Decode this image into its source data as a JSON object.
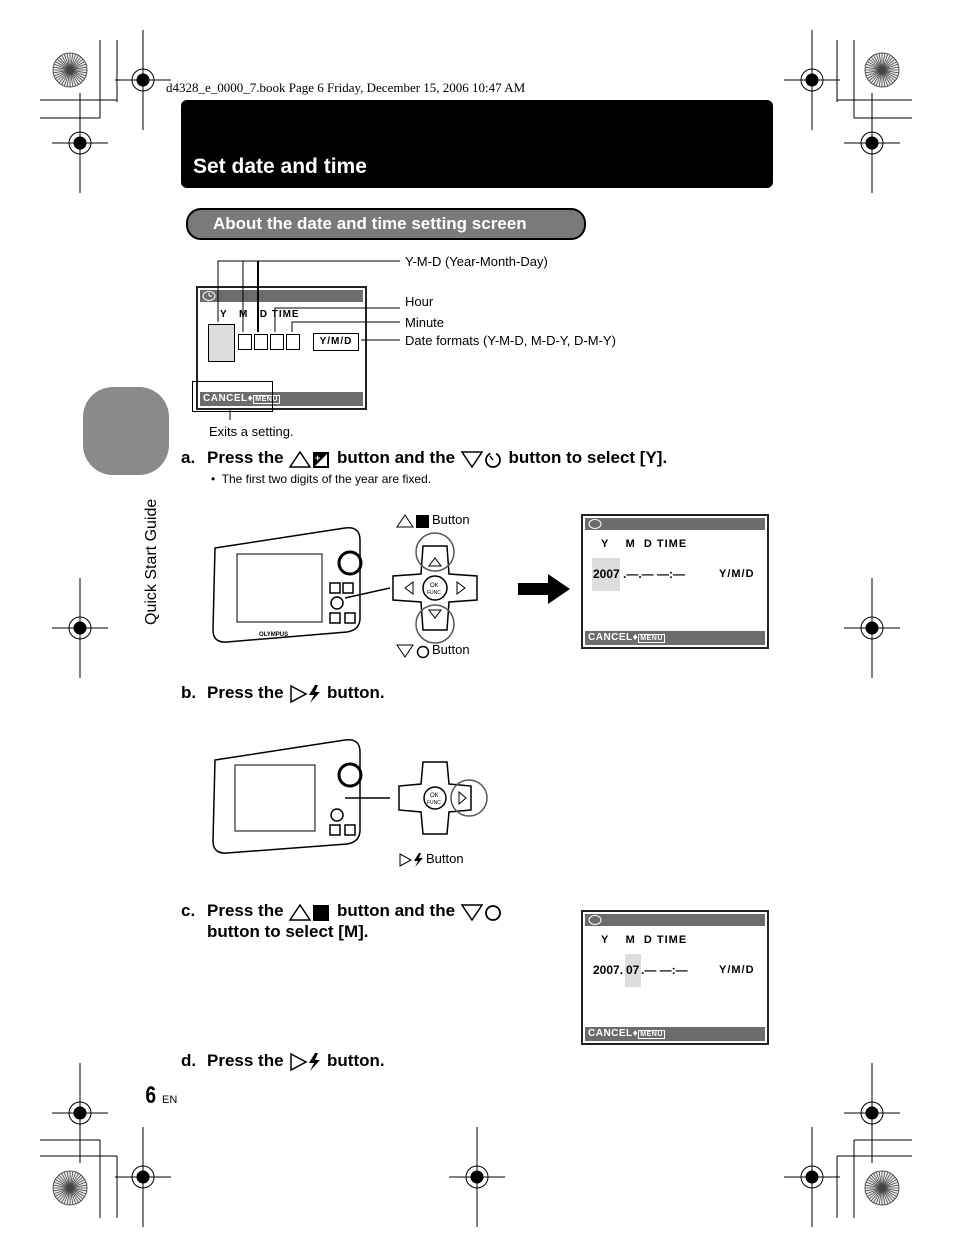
{
  "header": {
    "print_info": "d4328_e_0000_7.book  Page 6  Friday, December 15, 2006  10:47 AM"
  },
  "title": "Set date and time",
  "side_tab": {
    "label": "Quick Start Guide"
  },
  "section": {
    "heading": "About the date and time setting screen",
    "callouts": {
      "ymd": "Y-M-D (Year-Month-Day)",
      "hour": "Hour",
      "minute": "Minute",
      "formats": "Date formats (Y-M-D, M-D-Y, D-M-Y)",
      "exit": "Exits a setting."
    }
  },
  "lcd": {
    "headers": {
      "y": "Y",
      "m": "M",
      "d": "D",
      "time": "TIME"
    },
    "format": "Y/M/D",
    "cancel": "CANCEL",
    "menu": "MENU",
    "screen_a": {
      "year": "2007",
      "rest": ".—.— —:—"
    },
    "screen_c": {
      "year": "2007.",
      "month": "07",
      "rest": ".— —:—"
    }
  },
  "steps": [
    {
      "letter": "a.",
      "pre": "Press the",
      "mid": "button and the",
      "post": "button to select [Y].",
      "note": "The first two digits of the year are fixed."
    },
    {
      "letter": "b.",
      "pre": "Press the",
      "post": "button."
    },
    {
      "letter": "c.",
      "pre": "Press the",
      "mid": "button and the",
      "line2": "button to select [M]."
    },
    {
      "letter": "d.",
      "pre": "Press the",
      "post": "button."
    }
  ],
  "diagram_labels": {
    "up_button": "Button",
    "down_button": "Button",
    "right_button": "Button",
    "ok": "OK",
    "func": "FUNC",
    "brand": "OLYMPUS"
  },
  "footer": {
    "page_number": "6",
    "lang": "EN"
  }
}
